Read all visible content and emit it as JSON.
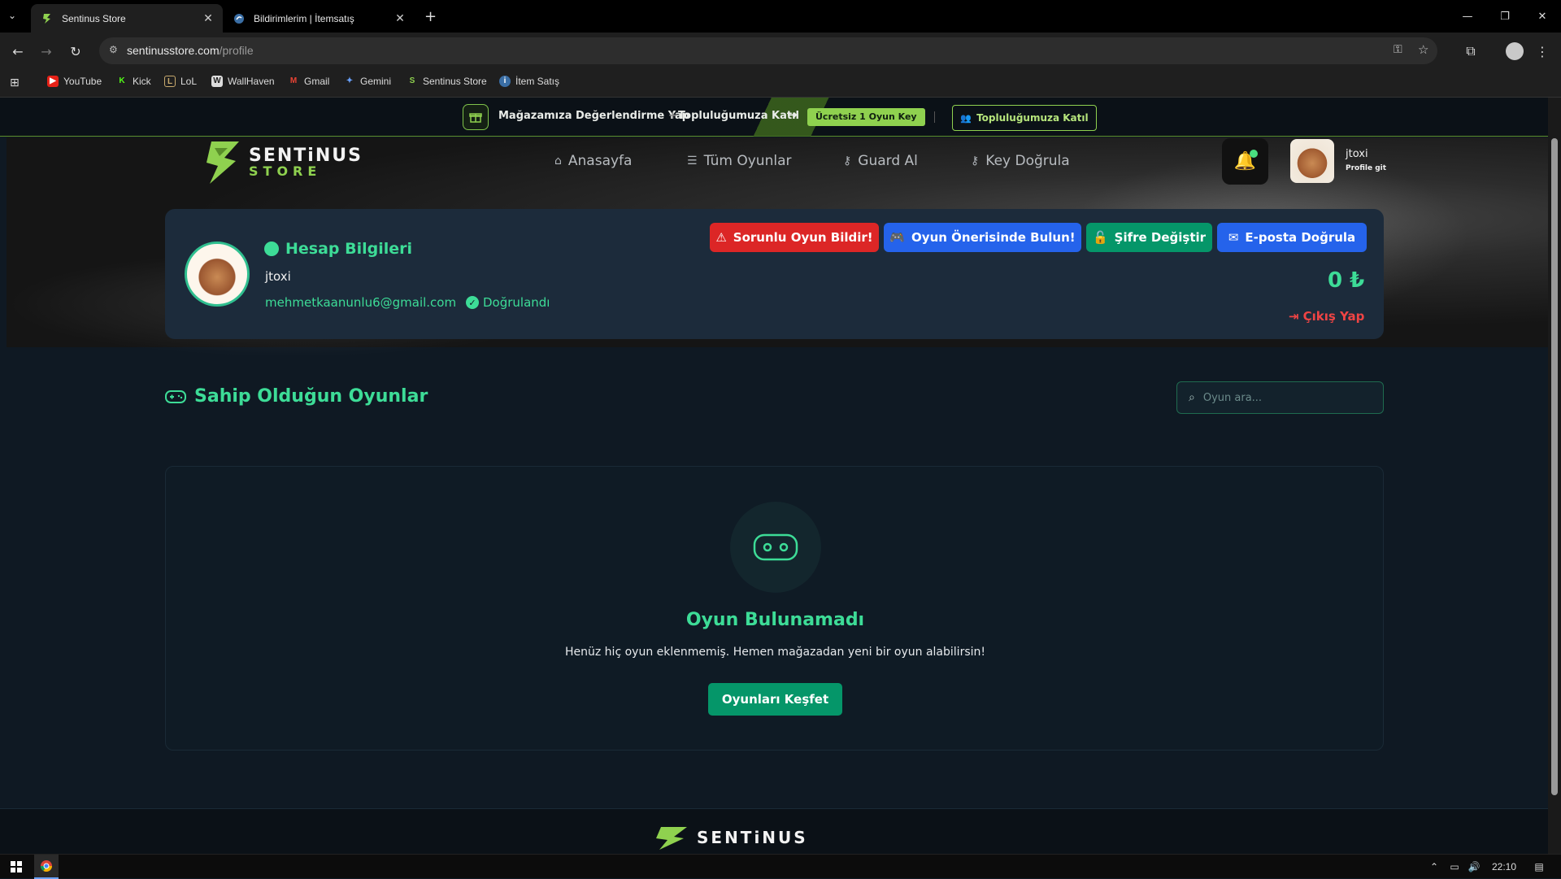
{
  "browser": {
    "tabs": [
      {
        "title": "Sentinus Store",
        "active": true
      },
      {
        "title": "Bildirimlerim | İtemsatış",
        "active": false
      }
    ],
    "url_host": "sentinusstore.com",
    "url_path": "/profile",
    "bookmarks": [
      "YouTube",
      "Kick",
      "LoL",
      "WallHaven",
      "Gmail",
      "Gemini",
      "Sentinus Store",
      "İtem Satış"
    ]
  },
  "promo": {
    "text1": "Mağazamıza Değerlendirme Yap",
    "plus": "+",
    "text2": "Topluluğumuza Katıl",
    "arrow": "→",
    "badge": "Ücretsiz 1 Oyun Key",
    "join_button": "Topluluğumuza Katıl"
  },
  "header": {
    "logo_top": "SENTiNUS",
    "logo_bottom": "STORE",
    "nav": [
      "Anasayfa",
      "Tüm Oyunlar",
      "Guard Al",
      "Key Doğrula"
    ],
    "username": "jtoxi",
    "profile_link": "Profile git"
  },
  "account": {
    "title": "Hesap Bilgileri",
    "username": "jtoxi",
    "email": "mehmetkaanunlu6@gmail.com",
    "verified": "Doğrulandı",
    "buttons": {
      "report": "Sorunlu Oyun Bildir!",
      "suggest": "Oyun Önerisinde Bulun!",
      "password": "Şifre Değiştir",
      "verify_email": "E-posta Doğrula"
    },
    "balance": "0 ₺",
    "logout": "Çıkış Yap"
  },
  "games": {
    "title": "Sahip Olduğun Oyunlar",
    "search_placeholder": "Oyun ara...",
    "empty_title": "Oyun Bulunamadı",
    "empty_subtitle": "Henüz hiç oyun eklenmemiş. Hemen mağazadan yeni bir oyun alabilirsin!",
    "explore_button": "Oyunları Keşfet"
  },
  "footer": {
    "logo": "SENTiNUS"
  },
  "taskbar": {
    "time": "22:10"
  },
  "colors": {
    "accent": "#3ddc97",
    "lime": "#8fd14f",
    "danger": "#dc2626",
    "primary": "#2563eb",
    "success": "#059669"
  }
}
